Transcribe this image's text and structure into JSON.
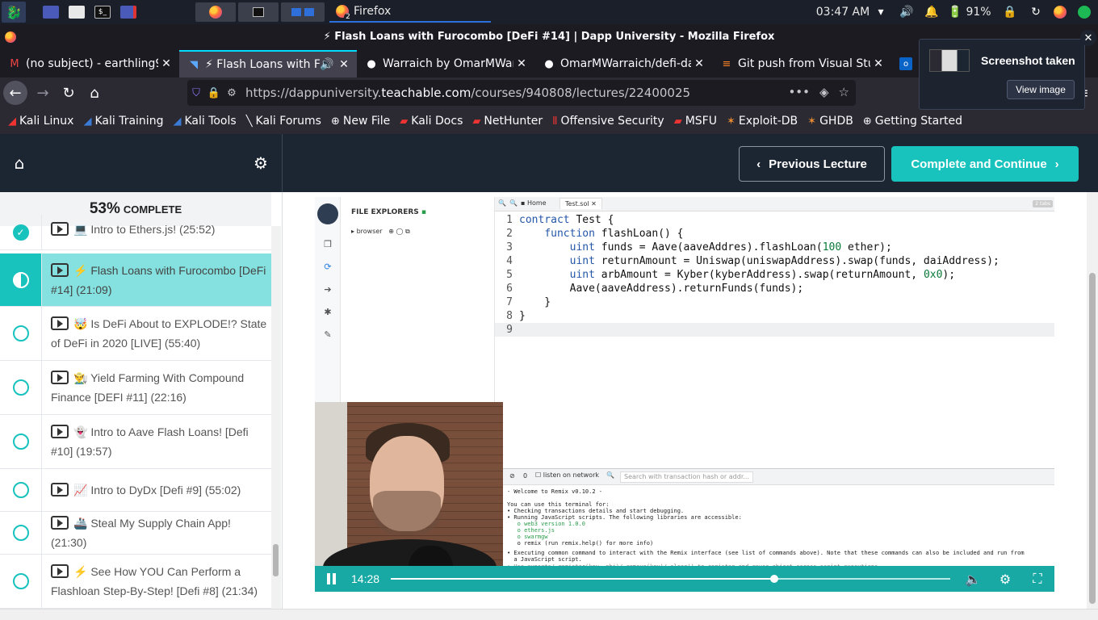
{
  "panel": {
    "clock": "03:47 AM",
    "battery": "91%",
    "active_task": "Firefox",
    "task_badge": "2"
  },
  "window": {
    "title": "⚡ Flash Loans with Furocombo [DeFi #14] | Dapp University - Mozilla Firefox"
  },
  "tabs": [
    {
      "title": "(no subject) - earthling9€",
      "icon": "gmail-icon"
    },
    {
      "title": "⚡ Flash Loans with Fu",
      "icon": "teachable-icon"
    },
    {
      "title": "Warraich by OmarMWar",
      "icon": "github-icon"
    },
    {
      "title": "OmarMWarraich/defi-da",
      "icon": "github-icon"
    },
    {
      "title": "Git push from Visual Stu",
      "icon": "stackoverflow-icon"
    },
    {
      "title": "",
      "icon": "outlook-icon"
    }
  ],
  "urlbar": {
    "prefix": "https://dappuniversity.",
    "host": "teachable.com",
    "path": "/courses/940808/lectures/22400025"
  },
  "bookmarks": [
    {
      "label": "Kali Linux",
      "icon": "kali-icon"
    },
    {
      "label": "Kali Training",
      "icon": "kali-icon"
    },
    {
      "label": "Kali Tools",
      "icon": "kali-icon"
    },
    {
      "label": "Kali Forums",
      "icon": "kali-forums-icon"
    },
    {
      "label": "New File",
      "icon": "globe-icon"
    },
    {
      "label": "Kali Docs",
      "icon": "kali-docs-icon"
    },
    {
      "label": "NetHunter",
      "icon": "nethunter-icon"
    },
    {
      "label": "Offensive Security",
      "icon": "offsec-icon"
    },
    {
      "label": "MSFU",
      "icon": "msfu-icon"
    },
    {
      "label": "Exploit-DB",
      "icon": "exploitdb-icon"
    },
    {
      "label": "GHDB",
      "icon": "ghdb-icon"
    },
    {
      "label": "Getting Started",
      "icon": "globe-icon"
    }
  ],
  "notification": {
    "title": "Screenshot taken",
    "button": "View image"
  },
  "course": {
    "prev_label": "Previous Lecture",
    "next_label": "Complete and Continue",
    "progress_pct": "53%",
    "progress_label": "COMPLETE",
    "lessons": [
      {
        "text": "💻 Intro to Ethers.js! (25:52)",
        "status": "done"
      },
      {
        "text": "⚡ Flash Loans with Furocombo [DeFi #14] (21:09)",
        "status": "current"
      },
      {
        "text": "🤯 Is DeFi About to EXPLODE!? State of DeFi in 2020 [LIVE] (55:40)",
        "status": "todo"
      },
      {
        "text": "👨‍🌾 Yield Farming With Compound Finance [DEFI #11] (22:16)",
        "status": "todo"
      },
      {
        "text": "👻 Intro to Aave Flash Loans! [Defi #10] (19:57)",
        "status": "todo"
      },
      {
        "text": "📈 Intro to DyDx [Defi #9] (55:02)",
        "status": "todo"
      },
      {
        "text": "🚢 Steal My Supply Chain App! (21:30)",
        "status": "todo"
      },
      {
        "text": "⚡ See How YOU Can Perform a Flashloan Step-By-Step! [Defi #8] (21:34)",
        "status": "todo"
      }
    ]
  },
  "video": {
    "time": "14:28",
    "progress": 0.685,
    "remix": {
      "file_explorers": "FILE EXPLORERS",
      "browser": "browser",
      "tab_home": "Home",
      "tab_file": "Test.sol",
      "tabs_count": "2 tabs",
      "code": [
        "contract Test {",
        "    function flashLoan() {",
        "        uint funds = Aave(aaveAddres).flashLoan(100 ether);",
        "        uint returnAmount = Uniswap(uniswapAddress).swap(funds, daiAddress);",
        "        uint arbAmount = Kyber(kyberAddress).swap(returnAmount, 0x0);",
        "        Aave(aaveAddress).returnFunds(funds);",
        "    }",
        "}",
        ""
      ],
      "terminal": {
        "count": "0",
        "listen": "listen on network",
        "search_placeholder": "Search with transaction hash or addr...",
        "lines": [
          "- Welcome to Remix v0.10.2 -",
          "",
          "You can use this terminal for:",
          "• Checking transactions details and start debugging.",
          "• Running JavaScript scripts. The following libraries are accessible:",
          "   o web3 version 1.0.0",
          "   o ethers.js",
          "   o swarmgw",
          "   o remix (run remix.help() for more info)",
          "• Executing common command to interact with the Remix interface (see list of commands above). Note that these commands can also be included and run from",
          "  a JavaScript script.",
          "• Use exports/.register(key, obj)/.remove(key)/.clear() to register and reuse object across script executions."
        ]
      }
    }
  }
}
